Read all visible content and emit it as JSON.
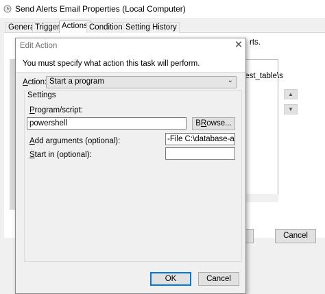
{
  "parent": {
    "title": "Send Alerts Email Properties (Local Computer)",
    "tabs": [
      "General",
      "Triggers",
      "Actions",
      "Conditions",
      "Settings",
      "History"
    ],
    "selected_tab": "Actions",
    "fragment_text": "rts.",
    "list_fragment": "test_table\\s",
    "cancel_label": "Cancel"
  },
  "dialog": {
    "title": "Edit Action",
    "close_glyph": "✕",
    "header_text": "You must specify what action this task will perform.",
    "action_label_key": "A",
    "action_label_rest": "ction:",
    "action_value": "Start a program",
    "settings_label": "Settings",
    "program_label_key": "P",
    "program_label_rest": "rogram/script:",
    "program_value": "powershell",
    "browse_label_key": "R",
    "browse_label_pre": "B",
    "browse_label_post": "owse...",
    "args_label_key": "A",
    "args_label_rest": "dd arguments (optional):",
    "args_value": "-File C:\\database-alerts.p",
    "start_label_key": "S",
    "start_label_rest": "tart in (optional):",
    "start_value": "",
    "ok_label": "OK",
    "cancel_label": "Cancel"
  },
  "colors": {
    "accent": "#0078d7",
    "window_bg": "#f0f0f0"
  }
}
